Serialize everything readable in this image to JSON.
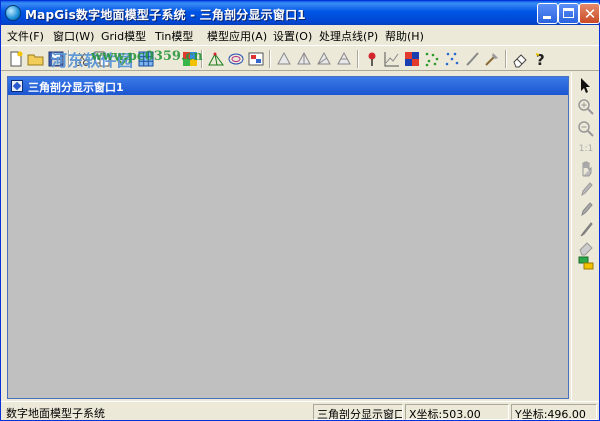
{
  "window": {
    "title": "MapGis数字地面模型子系统 - 三角剖分显示窗口1"
  },
  "menu": {
    "items": [
      {
        "label": "文件(F)"
      },
      {
        "label": "窗口(W)"
      },
      {
        "label": "Grid模型"
      },
      {
        "label": "Tin模型"
      },
      {
        "label": "模型应用(A)"
      },
      {
        "label": "设置(O)"
      },
      {
        "label": "处理点线(P)"
      },
      {
        "label": "帮助(H)"
      }
    ]
  },
  "watermark": {
    "text": "河东软件园",
    "url": "www.pc0359.cn"
  },
  "child_window": {
    "title": "三角剖分显示窗口1"
  },
  "toolbar": {
    "icons": [
      "new-file-icon",
      "open-folder-icon",
      "save-icon",
      "cut-icon",
      "copy-icon",
      "check-icon",
      "grid-icon",
      "color-grid-icon",
      "tin-icon",
      "profile-icon",
      "contour-icon",
      "color-map-icon",
      "triangle-icon-1",
      "triangle-icon-2",
      "triangle-icon-3",
      "triangle-icon-4",
      "pin-icon",
      "line-chart-icon",
      "color-block-icon",
      "dot-pattern-icon",
      "dot-pattern-icon-2",
      "brush-icon",
      "axe-icon",
      "eraser-icon",
      "help-icon"
    ]
  },
  "vtoolbar": {
    "icons": [
      "pointer-icon",
      "zoom-in-icon",
      "zoom-out-icon",
      "scale-1-1-icon",
      "pan-hand-icon",
      "pen-icon",
      "pencil-icon",
      "brush-tool-icon",
      "eraser-tool-icon",
      "layers-icon"
    ],
    "scale_label": "1:1"
  },
  "statusbar": {
    "main": "数字地面模型子系统",
    "window": "三角剖分显示窗口",
    "x": "X坐标:503.00",
    "y": "Y坐标:496.00"
  },
  "colors": {
    "titlebar": "#0055E5",
    "chrome": "#ECE9D8",
    "canvas": "#C0C0C0",
    "child_titlebar": "#1C55D0"
  }
}
